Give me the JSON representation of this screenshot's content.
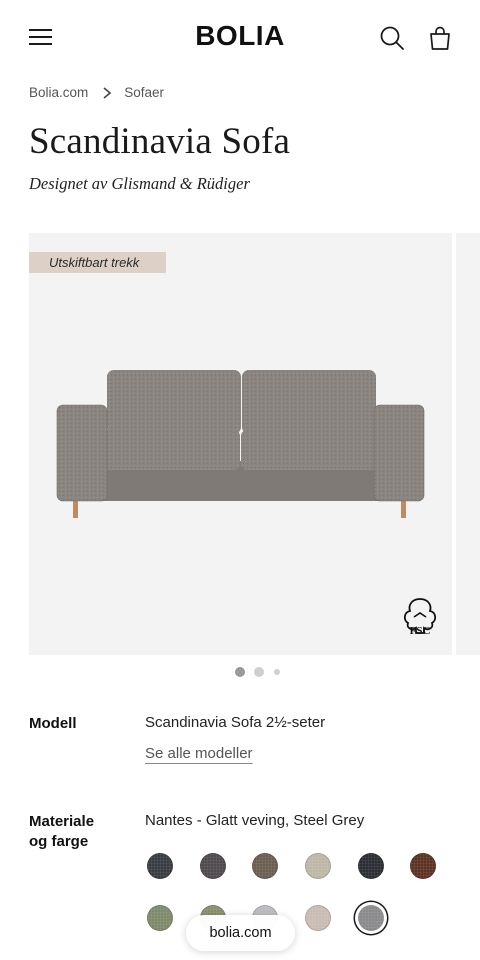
{
  "header": {
    "logo": "BOLIA",
    "menu_icon": "hamburger-menu-icon",
    "search_icon": "search-icon",
    "cart_icon": "shopping-bag-icon"
  },
  "breadcrumb": {
    "items": [
      "Bolia.com",
      "Sofaer"
    ],
    "separator_icon": "chevron-right-icon"
  },
  "product": {
    "title": "Scandinavia Sofa",
    "designer": "Designet av Glismand & Rüdiger"
  },
  "gallery": {
    "badge": "Utskiftbart trekk",
    "certification_icon": "fsc-logo-icon",
    "certification_label": "FSC",
    "slides": 3,
    "active_slide": 1
  },
  "model": {
    "label": "Modell",
    "value": "Scandinavia Sofa 2½-seter",
    "link": "Se alle modeller"
  },
  "material": {
    "label_line1": "Materiale",
    "label_line2": "og farge",
    "value": "Nantes - Glatt veving, Steel Grey",
    "swatches": [
      {
        "color": "#3a3c44"
      },
      {
        "color": "#4f4a4d"
      },
      {
        "color": "#6b5e52"
      },
      {
        "color": "#bfb7a6"
      },
      {
        "color": "#2b2e33"
      },
      {
        "color": "#5c3322"
      },
      {
        "color": "#7f8a6a"
      },
      {
        "color": "#8c8e70"
      },
      {
        "color": "#bcbcc0"
      },
      {
        "color": "#c9bcb4"
      },
      {
        "color": "#8a8a8c",
        "selected": true
      }
    ]
  },
  "footer_toast": {
    "url": "bolia.com"
  },
  "colors": {
    "gallery_bg": "#f3f3f3",
    "badge_bg": "#ddd0c6",
    "sofa_fabric": "#8a8580"
  }
}
